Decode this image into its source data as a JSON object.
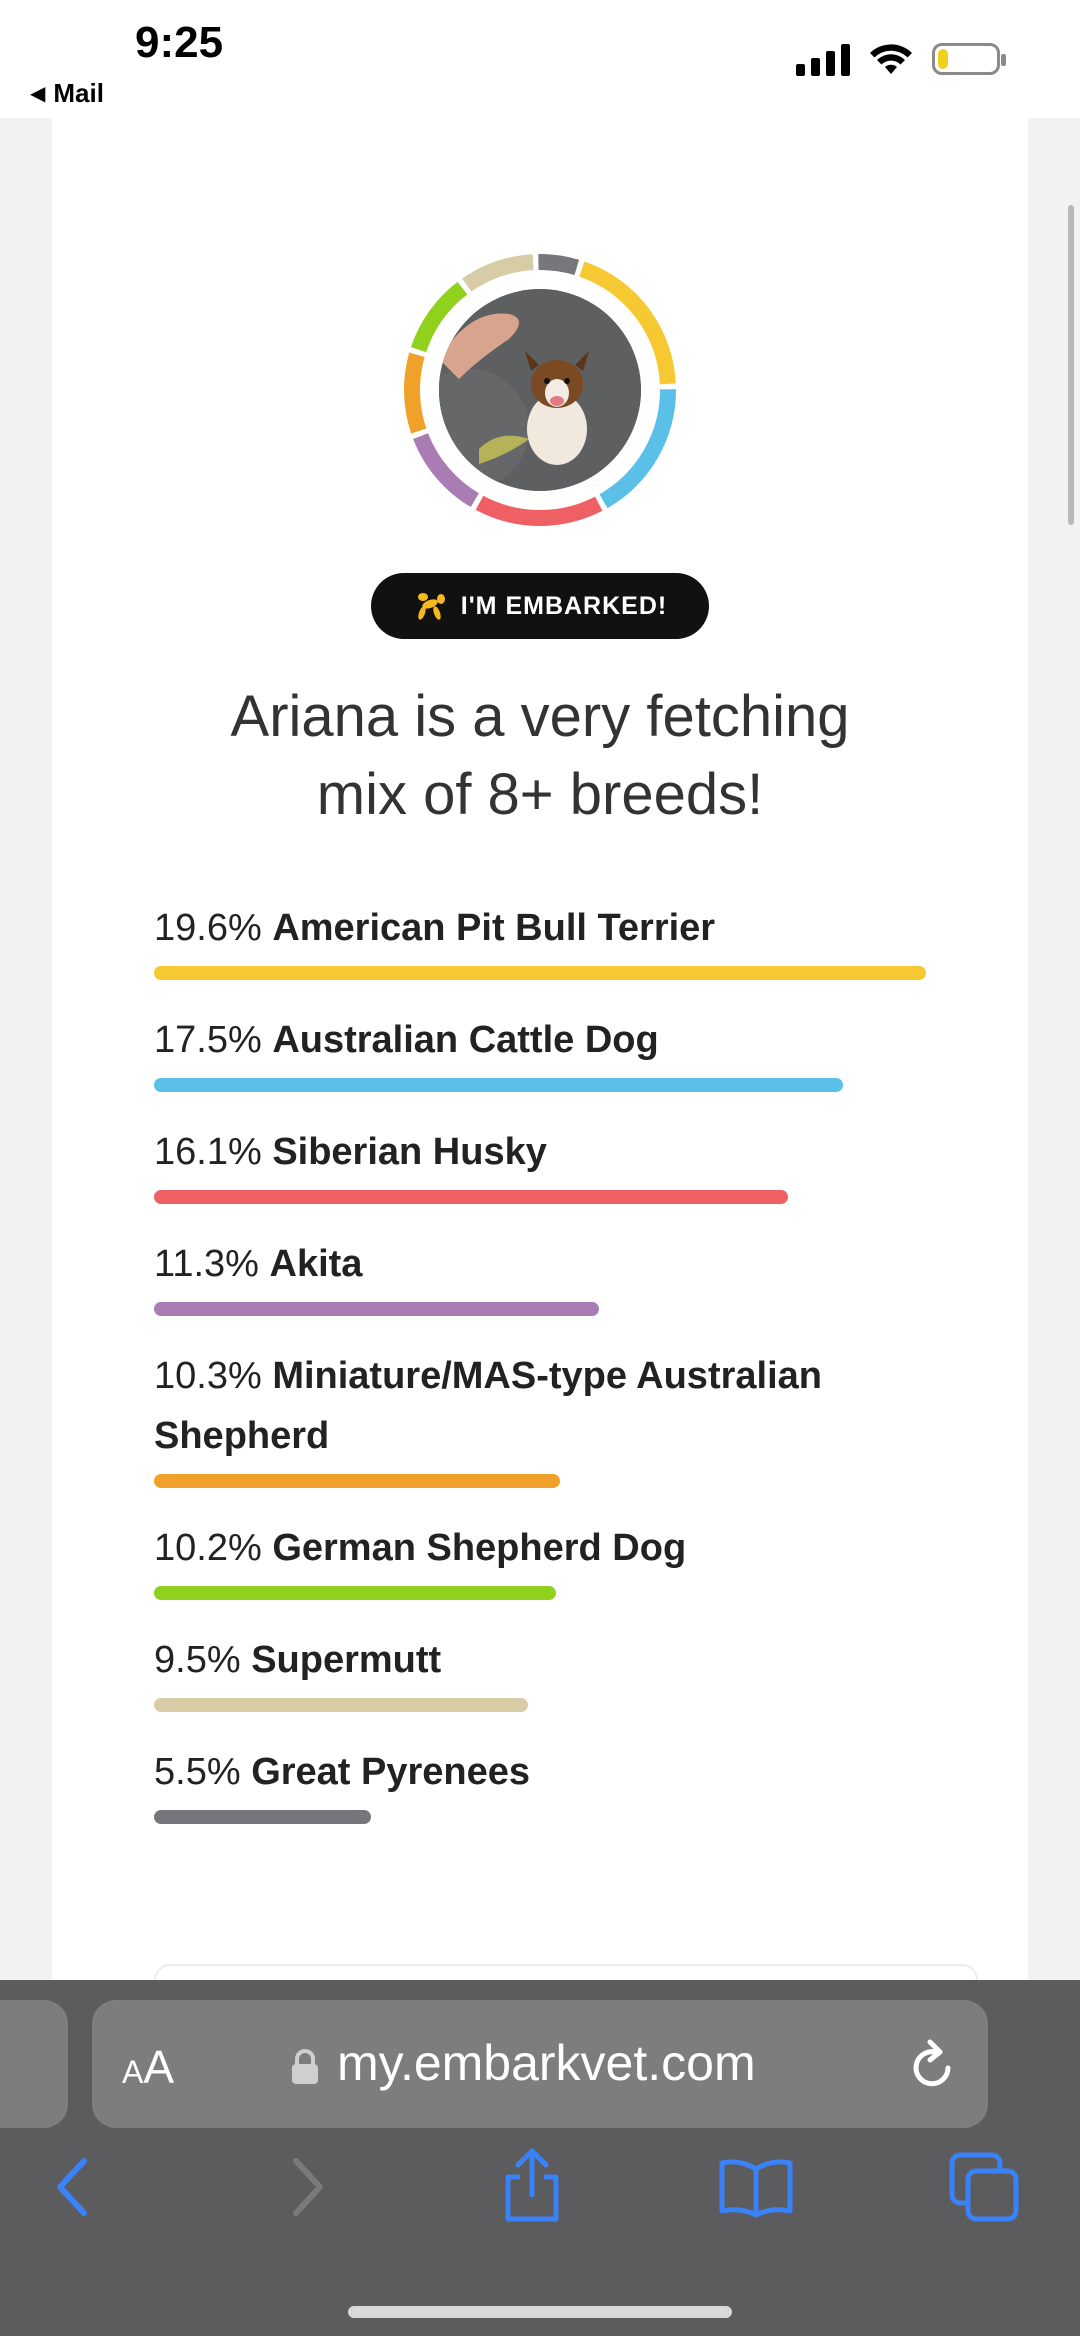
{
  "status_bar": {
    "time": "9:25",
    "back_label": "Mail",
    "icons": [
      "signal-icon",
      "wifi-icon",
      "battery-icon"
    ],
    "battery_level": 0.18
  },
  "profile": {
    "badge_text": "I'M EMBARKED!",
    "headline_line1": "Ariana is a very fetching",
    "headline_line2": "mix of 8+ breeds!"
  },
  "breeds": [
    {
      "percent": "19.6%",
      "name": "American Pit Bull Terrier",
      "value": 19.6,
      "color": "#f6c933"
    },
    {
      "percent": "17.5%",
      "name": "Australian Cattle Dog",
      "value": 17.5,
      "color": "#5bc0e8"
    },
    {
      "percent": "16.1%",
      "name": "Siberian Husky",
      "value": 16.1,
      "color": "#ef6065"
    },
    {
      "percent": "11.3%",
      "name": "Akita",
      "value": 11.3,
      "color": "#a97db3"
    },
    {
      "percent": "10.3%",
      "name": "Miniature/MAS-type Australian Shepherd",
      "value": 10.3,
      "color": "#f0a12a"
    },
    {
      "percent": "10.2%",
      "name": "German Shepherd Dog",
      "value": 10.2,
      "color": "#8fd11c"
    },
    {
      "percent": "9.5%",
      "name": "Supermutt",
      "value": 9.5,
      "color": "#d8cca6"
    },
    {
      "percent": "5.5%",
      "name": "Great Pyrenees",
      "value": 5.5,
      "color": "#76767c"
    }
  ],
  "browser": {
    "aa_small": "A",
    "aa_big": "A",
    "url": "my.embarkvet.com",
    "toolbar_icons": [
      "back-icon",
      "forward-icon",
      "share-icon",
      "bookmarks-icon",
      "tabs-icon"
    ]
  },
  "colors": {
    "ios_blue": "#3a82f7",
    "chrome_bg": "#5c5c5e"
  }
}
